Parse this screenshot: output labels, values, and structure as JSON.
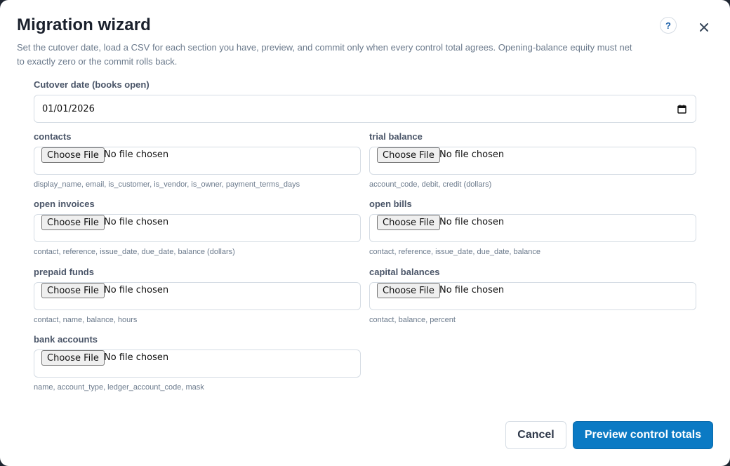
{
  "dialog": {
    "title": "Migration wizard",
    "subtitle": "Set the cutover date, load a CSV for each section you have, preview, and commit only when every control total agrees. Opening-balance equity must net to exactly zero or the commit rolls back.",
    "help_label": "?",
    "close_icon": "close-icon"
  },
  "cutover": {
    "label": "Cutover date (books open)",
    "value": "01/01/2026",
    "icon": "calendar-icon"
  },
  "sections": [
    {
      "label": "contacts",
      "button": "Choose File",
      "status": "No file chosen",
      "hint": "display_name, email, is_customer, is_vendor, is_owner, payment_terms_days"
    },
    {
      "label": "trial balance",
      "button": "Choose File",
      "status": "No file chosen",
      "hint": "account_code, debit, credit (dollars)"
    },
    {
      "label": "open invoices",
      "button": "Choose File",
      "status": "No file chosen",
      "hint": "contact, reference, issue_date, due_date, balance (dollars)"
    },
    {
      "label": "open bills",
      "button": "Choose File",
      "status": "No file chosen",
      "hint": "contact, reference, issue_date, due_date, balance"
    },
    {
      "label": "prepaid funds",
      "button": "Choose File",
      "status": "No file chosen",
      "hint": "contact, name, balance, hours"
    },
    {
      "label": "capital balances",
      "button": "Choose File",
      "status": "No file chosen",
      "hint": "contact, balance, percent"
    },
    {
      "label": "bank accounts",
      "button": "Choose File",
      "status": "No file chosen",
      "hint": "name, account_type, ledger_account_code, mask"
    }
  ],
  "footer": {
    "cancel_label": "Cancel",
    "primary_label": "Preview control totals",
    "primary_color": "#0b7ac4"
  }
}
